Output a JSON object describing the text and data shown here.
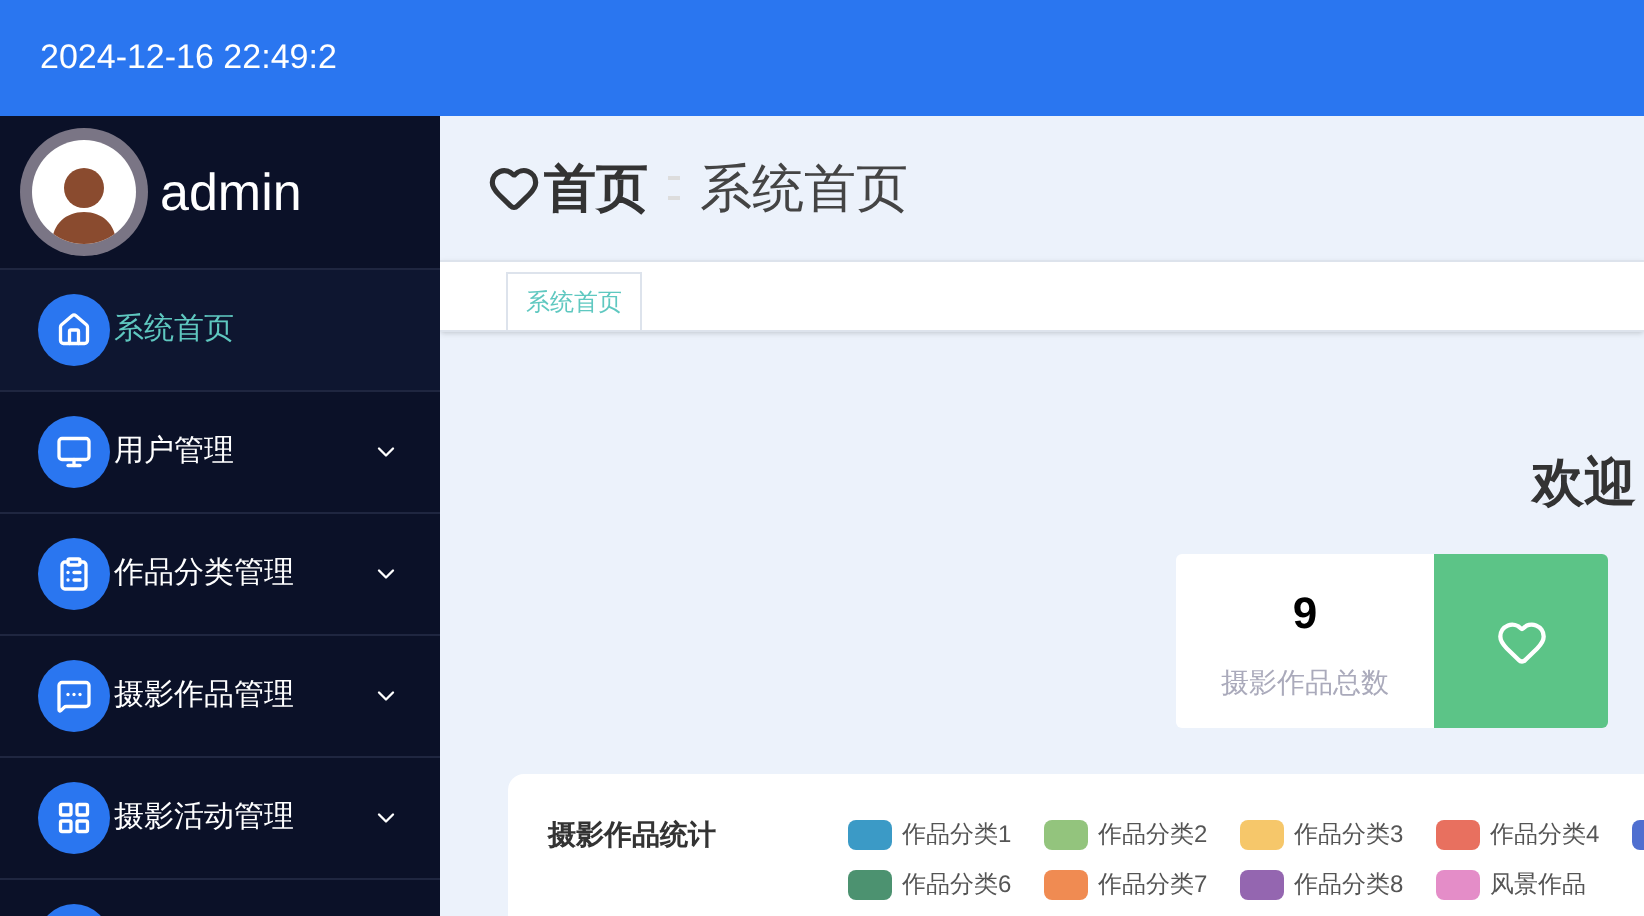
{
  "top_bar": {
    "datetime": "2024-12-16 22:49:2"
  },
  "user": {
    "name": "admin"
  },
  "sidebar": {
    "items": [
      {
        "label": "系统首页",
        "selected": true,
        "expandable": false
      },
      {
        "label": "用户管理",
        "selected": false,
        "expandable": true
      },
      {
        "label": "作品分类管理",
        "selected": false,
        "expandable": true
      },
      {
        "label": "摄影作品管理",
        "selected": false,
        "expandable": true
      },
      {
        "label": "摄影活动管理",
        "selected": false,
        "expandable": true
      }
    ]
  },
  "header": {
    "title": "首页",
    "breadcrumb": "系统首页"
  },
  "tabs": [
    {
      "label": "系统首页",
      "selected": true
    }
  ],
  "welcome": "欢迎",
  "stat": {
    "value": "9",
    "label": "摄影作品总数"
  },
  "chart_card": {
    "title": "摄影作品统计",
    "legend": [
      {
        "label": "作品分类1",
        "color": "#3b9ac6"
      },
      {
        "label": "作品分类2",
        "color": "#93c47d"
      },
      {
        "label": "作品分类3",
        "color": "#f6c76a"
      },
      {
        "label": "作品分类4",
        "color": "#e8705f"
      },
      {
        "color": "#4f6fd0"
      },
      {
        "label": "作品分类6",
        "color": "#4c9270"
      },
      {
        "label": "作品分类7",
        "color": "#f08b52"
      },
      {
        "label": "作品分类8",
        "color": "#9466b0"
      },
      {
        "label": "风景作品",
        "color": "#e48dc8"
      }
    ]
  }
}
